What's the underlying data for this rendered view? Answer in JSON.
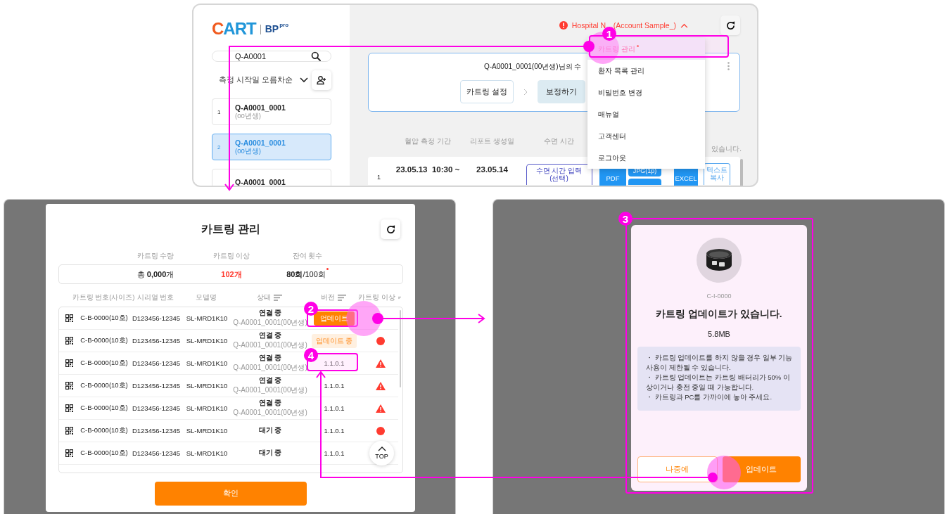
{
  "top_screen": {
    "logo": {
      "brand": "CART",
      "product": "BP",
      "tier": "pro"
    },
    "search": {
      "value": "Q-A0001"
    },
    "sort": {
      "label": "측정 시작일 오름차순"
    },
    "patients": [
      {
        "index": "1",
        "name": "Q-A0001_0001",
        "birth": "(00년생)",
        "selected": false
      },
      {
        "index": "2",
        "name": "Q-A0001_0001",
        "birth": "(00년생)",
        "selected": true
      },
      {
        "name": "Q-A0001_0001",
        "selected": false
      }
    ],
    "account": {
      "label": "Hospital N…(Account Sample_)",
      "expanded": true
    },
    "card": {
      "title": "Q-A0001_0001(00년생)님의 수",
      "steps": [
        {
          "label": "카트링 설정",
          "selected": false
        },
        {
          "label": "보정하기",
          "selected": true
        }
      ]
    },
    "table": {
      "columns": [
        "혈압 측정 기간",
        "리포트 생성일",
        "수면 시간"
      ],
      "note": "있습니다.",
      "rows": [
        {
          "index": "1",
          "period": "23.05.13  10:30 ~",
          "report_date": "23.05.14",
          "sleep_button": {
            "label": "수면 시간 입력",
            "sub": "(선택)"
          },
          "exports": [
            "PDF",
            "JPG(1p)",
            "EXCEL"
          ],
          "copy": "텍스트 복사"
        }
      ]
    },
    "menu": [
      {
        "label": "카트링 관리",
        "selected": true,
        "new": true
      },
      {
        "label": "환자 목록 관리",
        "selected": false,
        "new": false
      },
      {
        "label": "비밀번호 변경",
        "selected": false,
        "new": false
      },
      {
        "label": "매뉴얼",
        "selected": false,
        "new": false
      },
      {
        "label": "고객센터",
        "selected": false,
        "new": false
      },
      {
        "label": "로그아웃",
        "selected": false,
        "new": false
      }
    ]
  },
  "cartring_modal": {
    "title": "카트링 관리",
    "stats": [
      {
        "label": "카트링 수량",
        "value": "총 **0,000**개",
        "alert": false,
        "new": false
      },
      {
        "label": "카트링 이상",
        "value": "102개",
        "alert": true,
        "new": false
      },
      {
        "label": "잔여 횟수",
        "value": "**80회**/100회",
        "alert": false,
        "new": true
      }
    ],
    "columns": [
      {
        "label": "카트링 번호(사이즈)"
      },
      {
        "label": "시리얼 번호"
      },
      {
        "label": "모델명"
      },
      {
        "label": "상태",
        "sortable": true
      },
      {
        "label": "버전",
        "sortable": true
      },
      {
        "label": "카트링 이상",
        "sortable": true
      }
    ],
    "rows": [
      {
        "number": "C-B-0000(10호)",
        "serial": "D123456-12345",
        "model": "SL-MRD1K10",
        "status": "연결 중",
        "patient": "Q-A0001_0001(00년생)",
        "version": {
          "kind": "button",
          "label": "업데이트"
        }
      },
      {
        "number": "C-B-0000(10호)",
        "serial": "D123456-12345",
        "model": "SL-MRD1K10",
        "status": "연결 중",
        "patient": "Q-A0001_0001(00년생)",
        "version": {
          "kind": "progress",
          "label": "업데이트 중"
        },
        "issue": {
          "kind": "dot"
        }
      },
      {
        "number": "C-B-0000(10호)",
        "serial": "D123456-12345",
        "model": "SL-MRD1K10",
        "status": "연결 중",
        "patient": "Q-A0001_0001(00년생)",
        "version": {
          "kind": "text",
          "label": "1.1.0.1"
        },
        "issue": {
          "kind": "warning"
        }
      },
      {
        "number": "C-B-0000(10호)",
        "serial": "D123456-12345",
        "model": "SL-MRD1K10",
        "status": "연결 중",
        "patient": "Q-A0001_0001(00년생)",
        "version": {
          "kind": "text",
          "label": "1.1.0.1"
        },
        "issue": {
          "kind": "warning"
        }
      },
      {
        "number": "C-B-0000(10호)",
        "serial": "D123456-12345",
        "model": "SL-MRD1K10",
        "status": "연결 중",
        "patient": "Q-A0001_0001(00년생)",
        "version": {
          "kind": "text",
          "label": "1.1.0.1"
        },
        "issue": {
          "kind": "warning"
        }
      },
      {
        "number": "C-B-0000(10호)",
        "serial": "D123456-12345",
        "model": "SL-MRD1K10",
        "status": "대기 중",
        "version": {
          "kind": "text",
          "label": "1.1.0.1"
        },
        "issue": {
          "kind": "dot"
        }
      },
      {
        "number": "C-B-0000(10호)",
        "serial": "D123456-12345",
        "model": "SL-MRD1K10",
        "status": "대기 중",
        "version": {
          "kind": "text",
          "label": "1.1.0.1"
        }
      }
    ],
    "top_button": "TOP",
    "confirm": "확인"
  },
  "update_dialog": {
    "code": "C-I-0000",
    "title": "카트링 업데이트가 있습니다.",
    "size": "5.8MB",
    "notes": [
      "・ 카트링 업데이트를 하지 않을 경우 일부 기능 사용이 제한될 수 있습니다.",
      "・ 카트링 업데이트는 카트링 배터리가 50% 이상이거나 충전 중일 때 가능합니다.",
      "・ 카트링과 PC를 가까이에 놓아 주세요."
    ],
    "buttons": [
      {
        "label": "나중에",
        "kind": "secondary"
      },
      {
        "label": "업데이트",
        "kind": "primary"
      }
    ]
  },
  "annotations": [
    {
      "label": "1"
    },
    {
      "label": "2"
    },
    {
      "label": "3"
    },
    {
      "label": "4"
    }
  ]
}
